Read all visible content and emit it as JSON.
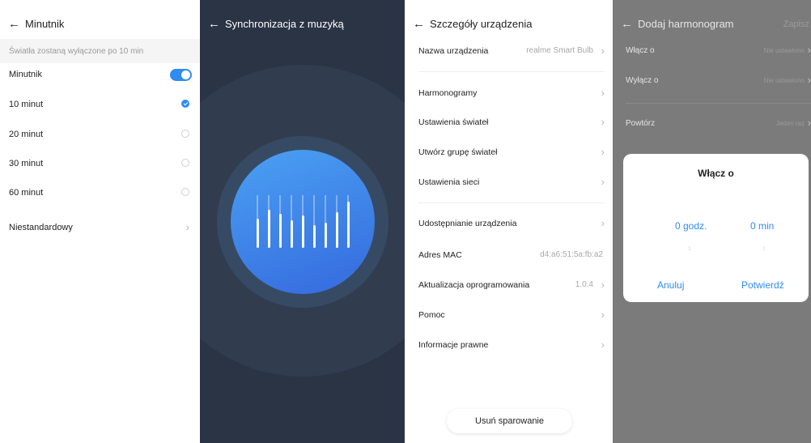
{
  "timer": {
    "title": "Minutnik",
    "subtitle": "Światła zostaną wyłączone po 10 min",
    "toggle_label": "Minutnik",
    "toggle_on": true,
    "options": [
      {
        "label": "10 minut",
        "selected": true
      },
      {
        "label": "20 minut",
        "selected": false
      },
      {
        "label": "30 minut",
        "selected": false
      },
      {
        "label": "60 minut",
        "selected": false
      }
    ],
    "custom_label": "Niestandardowy"
  },
  "music": {
    "title": "Synchronizacja z muzyką",
    "bar_levels": [
      0.55,
      0.72,
      0.65,
      0.52,
      0.62,
      0.43,
      0.48,
      0.68,
      0.88
    ]
  },
  "device": {
    "title": "Szczegóły urządzenia",
    "name_label": "Nazwa urządzenia",
    "name_value": "realme Smart Bulb",
    "group1": [
      {
        "label": "Harmonogramy"
      },
      {
        "label": "Ustawienia świateł"
      },
      {
        "label": "Utwórz grupę świateł"
      },
      {
        "label": "Ustawienia sieci"
      }
    ],
    "share_label": "Udostępnianie urządzenia",
    "mac_label": "Adres MAC",
    "mac_value": "d4:a6:51:5a:fb:a2",
    "firmware_label": "Aktualizacja oprogramowania",
    "firmware_value": "1.0.4",
    "help_label": "Pomoc",
    "legal_label": "Informacje prawne",
    "unpair_label": "Usuń sparowanie"
  },
  "schedule": {
    "title": "Dodaj harmonogram",
    "save_label": "Zapisz",
    "on_label": "Włącz o",
    "on_value": "Nie ustawiono",
    "off_label": "Wyłącz o",
    "off_value": "Nie ustawiono",
    "repeat_label": "Powtórz",
    "repeat_value": "Jeden raz",
    "dialog": {
      "title": "Włącz o",
      "hours": "0 godz.",
      "minutes": "0 min",
      "hours_next": "1",
      "minutes_next": "1",
      "cancel_label": "Anuluj",
      "confirm_label": "Potwierdź"
    }
  },
  "colors": {
    "accent": "#2f8cf0",
    "dark_bg": "#2b3445",
    "circle_outer": "#313c4f",
    "circle_middle": "#374a63",
    "circle_core": "#3b7de6"
  },
  "icons": {
    "back": "back-arrow-icon",
    "chevron": "chevron-right-icon",
    "check": "check-icon"
  }
}
